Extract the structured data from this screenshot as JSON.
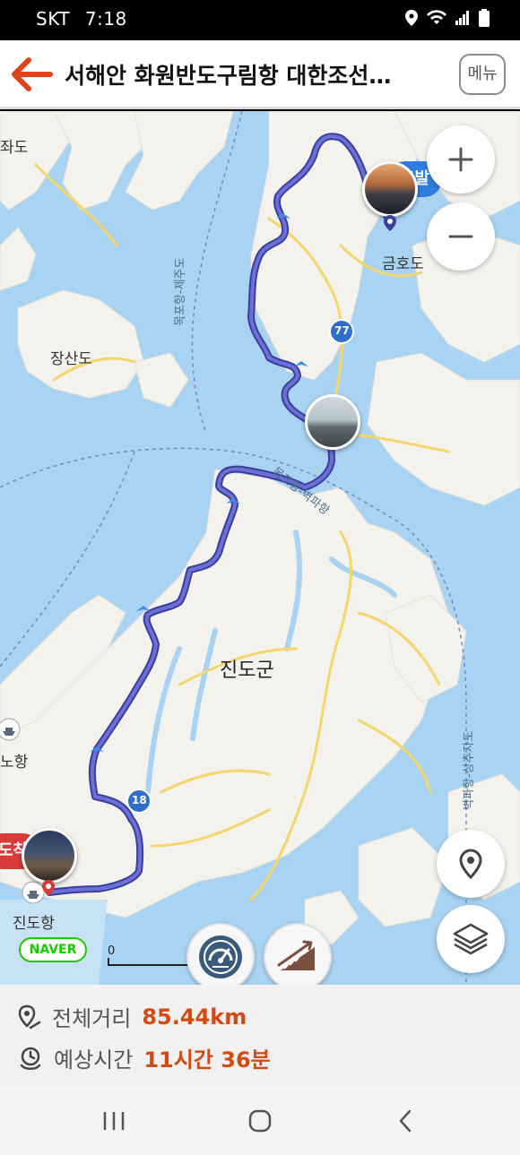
{
  "status_bar": {
    "carrier": "SKT",
    "time": "7:18",
    "icons": [
      "location-icon",
      "wifi-icon",
      "signal-icon",
      "battery-icon"
    ]
  },
  "header": {
    "back_icon": "arrow-left-icon",
    "title": "서해안 화원반도구림항 대한조선…",
    "menu_label": "메뉴"
  },
  "map": {
    "labels": {
      "island_left_top": "좌도",
      "geumhodo": "금호도",
      "jangsando": "장산도",
      "jindo_gun": "진도군",
      "noport": "노항",
      "jindo_port": "진도항"
    },
    "sea_routes": {
      "mokpo_jeju": "목포항-제주도",
      "mokpo_byeokpa": "목포항-벽파항",
      "byeokpa_sangjuja": "벽파항-상추자도"
    },
    "road_signs": {
      "route_77": "77",
      "route_18": "18"
    },
    "bubbles": {
      "start": "출발",
      "arrival": "도착"
    },
    "brand": "NAVER",
    "scale_label": "0",
    "colors": {
      "route": "#4b4fb0",
      "start_bubble": "#2f7de1",
      "arrival_bubble": "#d93a3a",
      "land": "#f4f2ec",
      "sea": "#a9d3f2",
      "road": "#f5d66b"
    }
  },
  "controls": {
    "zoom_in": "plus-icon",
    "zoom_out": "minus-icon",
    "my_location": "location-pin-icon",
    "layers": "layers-icon",
    "speedometer": "speedometer-icon",
    "slope": "slope-chart-icon"
  },
  "route_info": {
    "distance_label": "전체거리",
    "distance_value": "85.44km",
    "time_label": "예상시간",
    "time_value": "11시간 36분"
  },
  "nav_bar": {
    "recent": "recent-apps-icon",
    "home": "home-icon",
    "back": "back-chevron-icon"
  }
}
